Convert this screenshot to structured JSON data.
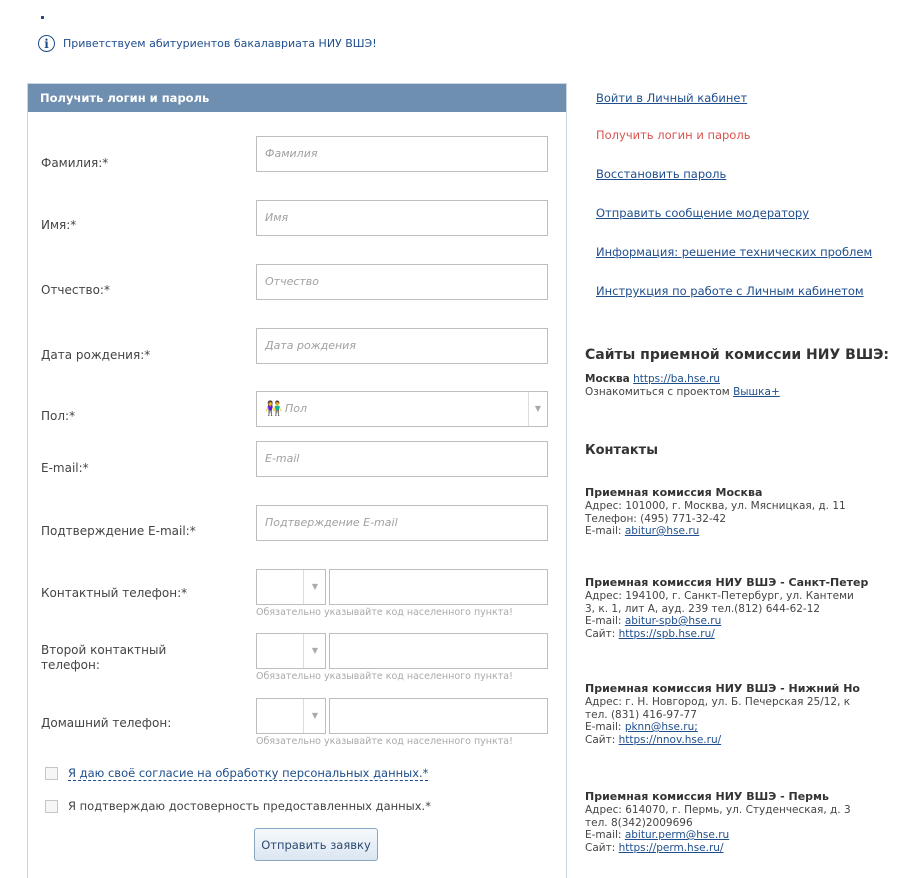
{
  "welcome": {
    "text": "Приветствуем абитуриентов бакалавриата НИУ ВШЭ!"
  },
  "form": {
    "title": "Получить логин и пароль",
    "fields": {
      "lastname": {
        "label": "Фамилия:*",
        "placeholder": "Фамилия"
      },
      "firstname": {
        "label": "Имя:*",
        "placeholder": "Имя"
      },
      "patronymic": {
        "label": "Отчество:*",
        "placeholder": "Отчество"
      },
      "birthdate": {
        "label": "Дата рождения:*",
        "placeholder": "Дата рождения"
      },
      "gender": {
        "label": "Пол:*",
        "placeholder": "Пол"
      },
      "email": {
        "label": "E-mail:*",
        "placeholder": "E-mail"
      },
      "email_confirm": {
        "label": "Подтверждение E-mail:*",
        "placeholder": "Подтверждение E-mail"
      },
      "phone": {
        "label": "Контактный телефон:*"
      },
      "phone2": {
        "label": "Второй контактный телефон:"
      },
      "home_phone": {
        "label": "Домашний телефон:"
      }
    },
    "phone_hint": "Обязательно указывайте код населенного пункта!",
    "consent_label": "Я даю своё согласие на обработку персональных данных.*",
    "confirm_label": "Я подтверждаю достоверность предоставленных данных.*",
    "submit_label": "Отправить заявку"
  },
  "nav": {
    "login": "Войти в Личный кабинет",
    "get_credentials": "Получить логин и пароль",
    "restore": "Восстановить пароль",
    "message": "Отправить сообщение модератору",
    "tech": "Информация: решение технических проблем",
    "manual": "Инструкция по работе с Личным кабинетом"
  },
  "sites": {
    "heading": "Сайты приемной комиссии НИУ ВШЭ:",
    "moscow_label": "Москва",
    "moscow_url": "https://ba.hse.ru",
    "project_text": "Ознакомиться с проектом",
    "project_link": "Вышка+"
  },
  "contacts": {
    "heading": "Контакты",
    "moscow": {
      "title": "Приемная комиссия Москва",
      "address": "Адрес: 101000, г. Москва, ул. Мясницкая, д. 11",
      "phone": "Телефон: (495) 771-32-42",
      "email_label": "E-mail:",
      "email": "abitur@hse.ru"
    },
    "spb": {
      "title": "Приемная комиссия НИУ ВШЭ - Санкт-Петер",
      "address": "Адрес: 194100, г. Санкт-Петербург, ул. Кантеми",
      "address2": "3, к. 1, лит А, ауд. 239 тел.(812) 644-62-12",
      "email_label": "E-mail:",
      "email": "abitur-spb@hse.ru",
      "site_label": "Сайт:",
      "site": "https://spb.hse.ru/"
    },
    "nnov": {
      "title": "Приемная комиссия НИУ ВШЭ - Нижний Но",
      "address": "Адрес: г. Н. Новгород, ул. Б. Печерская 25/12, к",
      "phone": "тел. (831) 416-97-77",
      "email_label": "E-mail:",
      "email": "pknn@hse.ru;",
      "site_label": "Сайт:",
      "site": "https://nnov.hse.ru/"
    },
    "perm": {
      "title": "Приемная комиссия НИУ ВШЭ - Пермь",
      "address": "Адрес: 614070, г. Пермь, ул. Студенческая, д. 3",
      "phone": "тел. 8(342)2009696",
      "email_label": "E-mail:",
      "email": "abitur.perm@hse.ru",
      "site_label": "Сайт:",
      "site": "https://perm.hse.ru/"
    }
  }
}
